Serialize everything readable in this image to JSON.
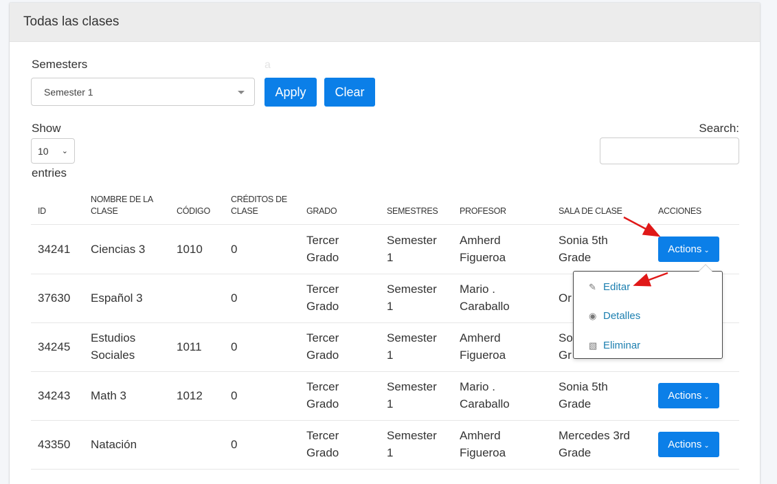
{
  "card": {
    "title": "Todas las clases"
  },
  "filter": {
    "label": "Semesters",
    "ghost": "a",
    "selected": "Semester 1",
    "apply": "Apply",
    "clear": "Clear"
  },
  "length": {
    "show": "Show",
    "value": "10",
    "entries": "entries"
  },
  "search": {
    "label": "Search:"
  },
  "table": {
    "headers": [
      "ID",
      "NOMBRE DE LA CLASE",
      "CÓDIGO",
      "CRÉDITOS DE CLASE",
      "GRADO",
      "SEMESTRES",
      "PROFESOR",
      "SALA DE CLASE",
      "ACCIONES"
    ],
    "rows": [
      {
        "id": "34241",
        "name": "Ciencias 3",
        "code": "1010",
        "credits": "0",
        "grado": "Tercer Grado",
        "semestre": "Semester 1",
        "profesor": "Amherd Figueroa",
        "sala": "Sonia 5th Grade",
        "action": "Actions"
      },
      {
        "id": "37630",
        "name": "Español 3",
        "code": "",
        "credits": "0",
        "grado": "Tercer Grado",
        "semestre": "Semester 1",
        "profesor": "Mario . Caraballo",
        "sala": "Or",
        "action": ""
      },
      {
        "id": "34245",
        "name": "Estudios Sociales",
        "code": "1011",
        "credits": "0",
        "grado": "Tercer Grado",
        "semestre": "Semester 1",
        "profesor": "Amherd Figueroa",
        "sala": "So Gr",
        "action": ""
      },
      {
        "id": "34243",
        "name": "Math 3",
        "code": "1012",
        "credits": "0",
        "grado": "Tercer Grado",
        "semestre": "Semester 1",
        "profesor": "Mario . Caraballo",
        "sala": "Sonia 5th Grade",
        "action": "Actions"
      },
      {
        "id": "43350",
        "name": "Natación",
        "code": "",
        "credits": "0",
        "grado": "Tercer Grado",
        "semestre": "Semester 1",
        "profesor": "Amherd Figueroa",
        "sala": "Mercedes 3rd Grade",
        "action": "Actions"
      }
    ]
  },
  "dropdown": {
    "items": [
      {
        "label": "Editar",
        "icon": "edit-icon"
      },
      {
        "label": "Detalles",
        "icon": "eye-icon"
      },
      {
        "label": "Eliminar",
        "icon": "trash-icon"
      }
    ]
  },
  "annotation": {
    "arrow_color": "#e01818"
  },
  "colors": {
    "primary": "#0b7fe8",
    "link": "#1c7fb0"
  }
}
